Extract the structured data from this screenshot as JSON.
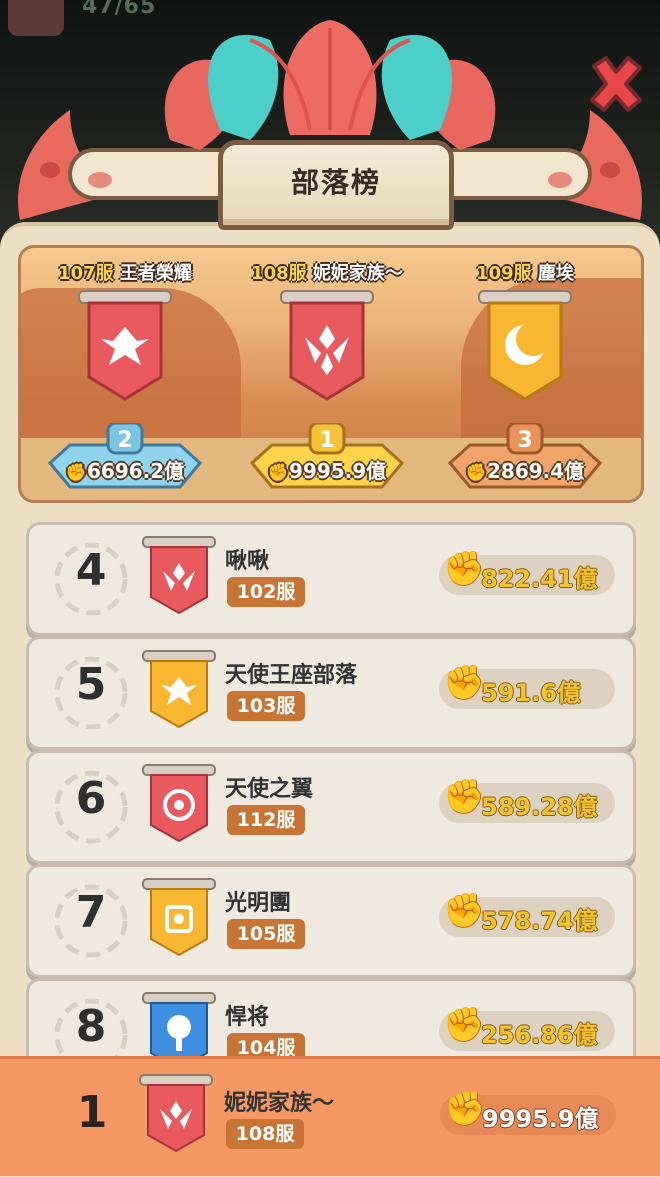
{
  "header": {
    "title": "部落榜",
    "counter": "47/65"
  },
  "podium": [
    {
      "place": "2",
      "server": "107服",
      "name": "王者榮耀",
      "power": "6696.2億",
      "flag_color": "#e85a5e",
      "emblem": "eagle-icon"
    },
    {
      "place": "1",
      "server": "108服",
      "name": "妮妮家族～",
      "power": "9995.9億",
      "flag_color": "#e85a5e",
      "emblem": "wing-crest-icon"
    },
    {
      "place": "3",
      "server": "109服",
      "name": "塵埃",
      "power": "2869.4億",
      "flag_color": "#f7b731",
      "emblem": "moon-icon"
    }
  ],
  "list": [
    {
      "rank": "4",
      "name": "啾啾",
      "server": "102服",
      "power": "822.41億",
      "flag_color": "#e85a5e",
      "emblem": "wing-crest-icon"
    },
    {
      "rank": "5",
      "name": "天使王座部落",
      "server": "103服",
      "power": "591.6億",
      "flag_color": "#f7b731",
      "emblem": "eagle-icon"
    },
    {
      "rank": "6",
      "name": "天使之翼",
      "server": "112服",
      "power": "589.28億",
      "flag_color": "#e85a5e",
      "emblem": "spiral-sun-icon"
    },
    {
      "rank": "7",
      "name": "光明團",
      "server": "105服",
      "power": "578.74億",
      "flag_color": "#f7b731",
      "emblem": "sun-icon"
    },
    {
      "rank": "8",
      "name": "悍将",
      "server": "104服",
      "power": "256.86億",
      "flag_color": "#3f8fe0",
      "emblem": "tree-icon"
    }
  ],
  "my_tribe": {
    "rank": "1",
    "name": "妮妮家族～",
    "server": "108服",
    "power": "9995.9億",
    "flag_color": "#e85a5e",
    "emblem": "wing-crest-icon"
  }
}
